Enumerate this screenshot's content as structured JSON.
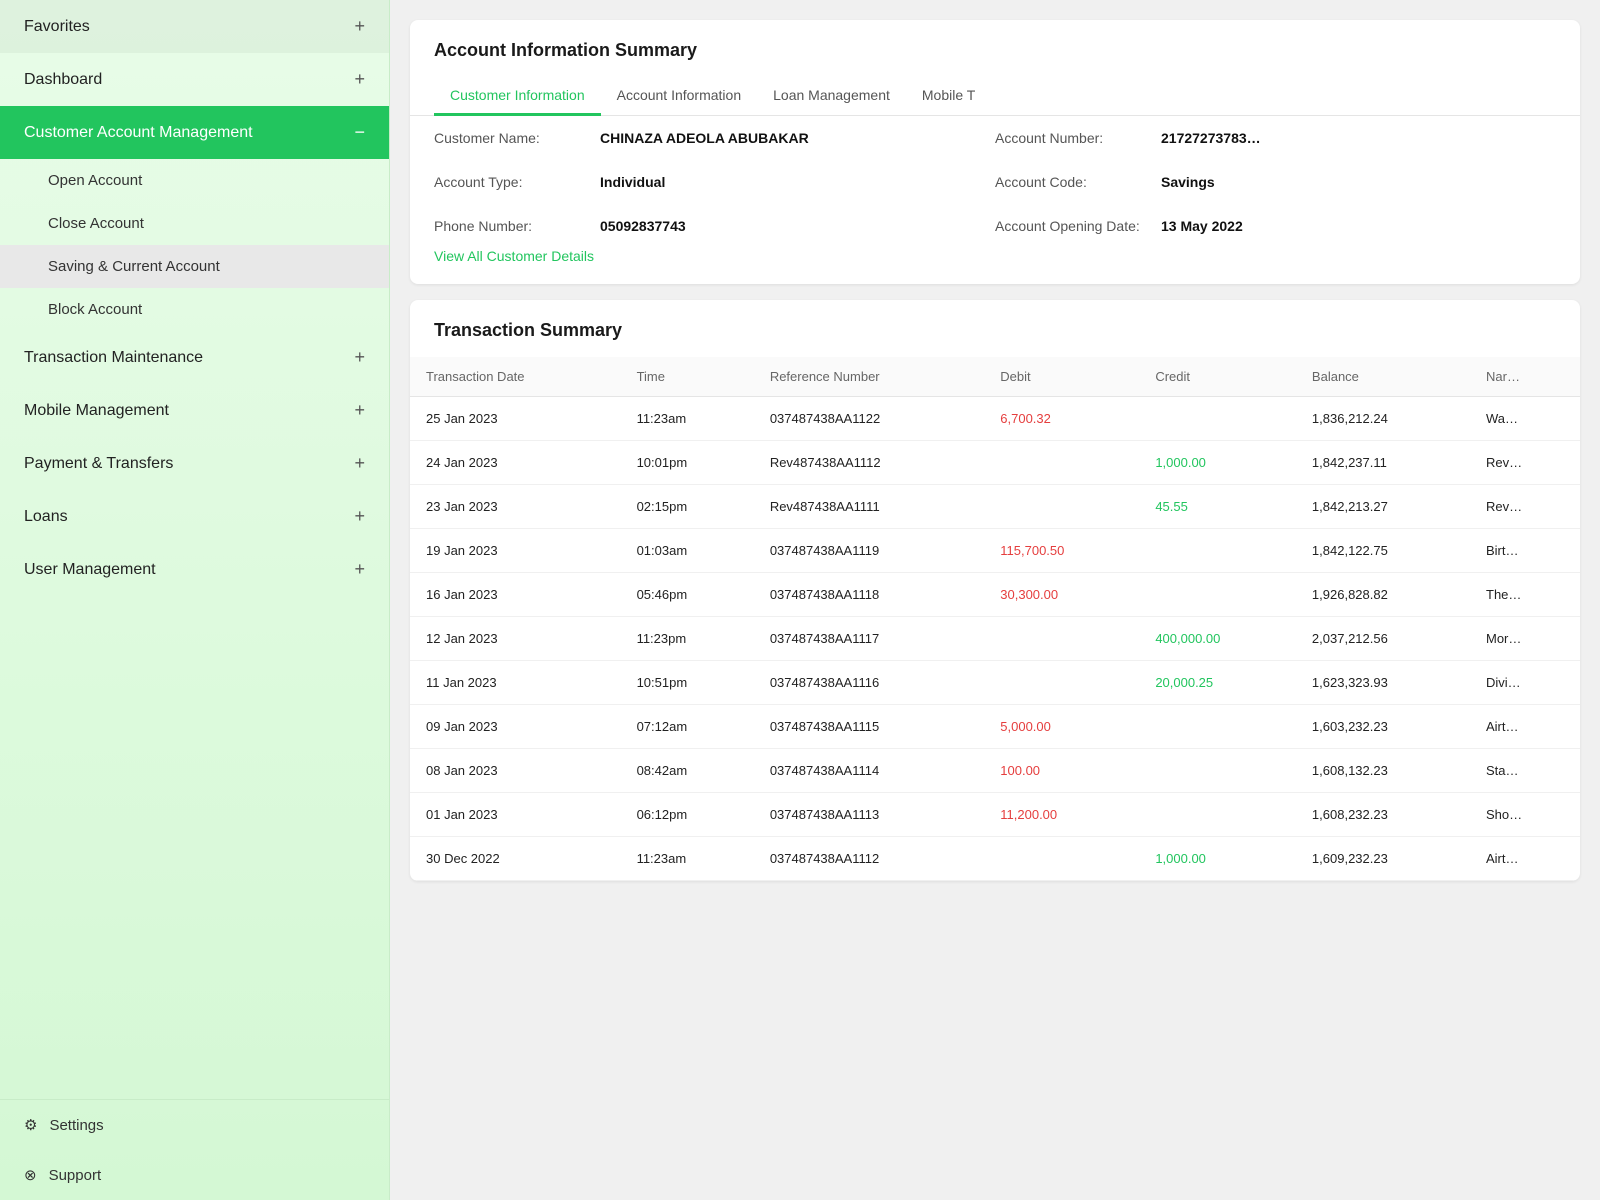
{
  "sidebar": {
    "items": [
      {
        "id": "favorites",
        "label": "Favorites",
        "icon": "+",
        "expanded": false
      },
      {
        "id": "dashboard",
        "label": "Dashboard",
        "icon": "+",
        "expanded": false
      },
      {
        "id": "customer-account-management",
        "label": "Customer Account Management",
        "icon": "−",
        "expanded": true,
        "active": true,
        "children": [
          {
            "id": "open-account",
            "label": "Open Account",
            "selected": false
          },
          {
            "id": "close-account",
            "label": "Close Account",
            "selected": false
          },
          {
            "id": "saving-current-account",
            "label": "Saving & Current Account",
            "selected": true
          },
          {
            "id": "block-account",
            "label": "Block Account",
            "selected": false
          }
        ]
      },
      {
        "id": "transaction-maintenance",
        "label": "Transaction Maintenance",
        "icon": "+",
        "expanded": false
      },
      {
        "id": "mobile-management",
        "label": "Mobile Management",
        "icon": "+",
        "expanded": false
      },
      {
        "id": "payment-transfers",
        "label": "Payment & Transfers",
        "icon": "+",
        "expanded": false
      },
      {
        "id": "loans",
        "label": "Loans",
        "icon": "+",
        "expanded": false
      },
      {
        "id": "user-management",
        "label": "User Management",
        "icon": "+",
        "expanded": false
      }
    ],
    "footer": [
      {
        "id": "settings",
        "label": "Settings",
        "icon": "⚙"
      },
      {
        "id": "support",
        "label": "Support",
        "icon": "⊗"
      }
    ]
  },
  "account_info": {
    "title": "Account Information Summary",
    "tabs": [
      {
        "id": "customer-information",
        "label": "Customer Information",
        "active": true
      },
      {
        "id": "account-information",
        "label": "Account Information",
        "active": false
      },
      {
        "id": "loan-management",
        "label": "Loan Management",
        "active": false
      },
      {
        "id": "mobile-t",
        "label": "Mobile T",
        "active": false
      }
    ],
    "fields": {
      "customer_name_label": "Customer Name:",
      "customer_name_value": "CHINAZA ADEOLA ABUBAKAR",
      "account_number_label": "Account Number:",
      "account_number_value": "21727273783…",
      "account_type_label": "Account Type:",
      "account_type_value": "Individual",
      "account_code_label": "Account Code:",
      "account_code_value": "Savings",
      "phone_number_label": "Phone Number:",
      "phone_number_value": "05092837743",
      "account_opening_date_label": "Account Opening Date:",
      "account_opening_date_value": "13 May 2022"
    },
    "view_all_link": "View All Customer Details"
  },
  "transaction_summary": {
    "title": "Transaction Summary",
    "columns": [
      {
        "id": "date",
        "label": "Transaction Date"
      },
      {
        "id": "time",
        "label": "Time"
      },
      {
        "id": "reference",
        "label": "Reference Number"
      },
      {
        "id": "debit",
        "label": "Debit"
      },
      {
        "id": "credit",
        "label": "Credit"
      },
      {
        "id": "balance",
        "label": "Balance"
      },
      {
        "id": "narration",
        "label": "Nar…"
      }
    ],
    "rows": [
      {
        "date": "25 Jan 2023",
        "time": "11:23am",
        "reference": "037487438AA1122",
        "debit": "6,700.32",
        "credit": "",
        "balance": "1,836,212.24",
        "narration": "Wa…"
      },
      {
        "date": "24 Jan 2023",
        "time": "10:01pm",
        "reference": "Rev487438AA1112",
        "debit": "",
        "credit": "1,000.00",
        "balance": "1,842,237.11",
        "narration": "Rev…"
      },
      {
        "date": "23 Jan 2023",
        "time": "02:15pm",
        "reference": "Rev487438AA1111",
        "debit": "",
        "credit": "45.55",
        "balance": "1,842,213.27",
        "narration": "Rev…"
      },
      {
        "date": "19 Jan 2023",
        "time": "01:03am",
        "reference": "037487438AA1119",
        "debit": "115,700.50",
        "credit": "",
        "balance": "1,842,122.75",
        "narration": "Birt…"
      },
      {
        "date": "16 Jan 2023",
        "time": "05:46pm",
        "reference": "037487438AA1118",
        "debit": "30,300.00",
        "credit": "",
        "balance": "1,926,828.82",
        "narration": "The…"
      },
      {
        "date": "12 Jan 2023",
        "time": "11:23pm",
        "reference": "037487438AA1117",
        "debit": "",
        "credit": "400,000.00",
        "balance": "2,037,212.56",
        "narration": "Mor…"
      },
      {
        "date": "11 Jan 2023",
        "time": "10:51pm",
        "reference": "037487438AA1116",
        "debit": "",
        "credit": "20,000.25",
        "balance": "1,623,323.93",
        "narration": "Divi…"
      },
      {
        "date": "09 Jan 2023",
        "time": "07:12am",
        "reference": "037487438AA1115",
        "debit": "5,000.00",
        "credit": "",
        "balance": "1,603,232.23",
        "narration": "Airt…"
      },
      {
        "date": "08 Jan 2023",
        "time": "08:42am",
        "reference": "037487438AA1114",
        "debit": "100.00",
        "credit": "",
        "balance": "1,608,132.23",
        "narration": "Sta…"
      },
      {
        "date": "01 Jan 2023",
        "time": "06:12pm",
        "reference": "037487438AA1113",
        "debit": "11,200.00",
        "credit": "",
        "balance": "1,608,232.23",
        "narration": "Sho…"
      },
      {
        "date": "30 Dec 2022",
        "time": "11:23am",
        "reference": "037487438AA1112",
        "debit": "",
        "credit": "1,000.00",
        "balance": "1,609,232.23",
        "narration": "Airt…"
      }
    ]
  }
}
